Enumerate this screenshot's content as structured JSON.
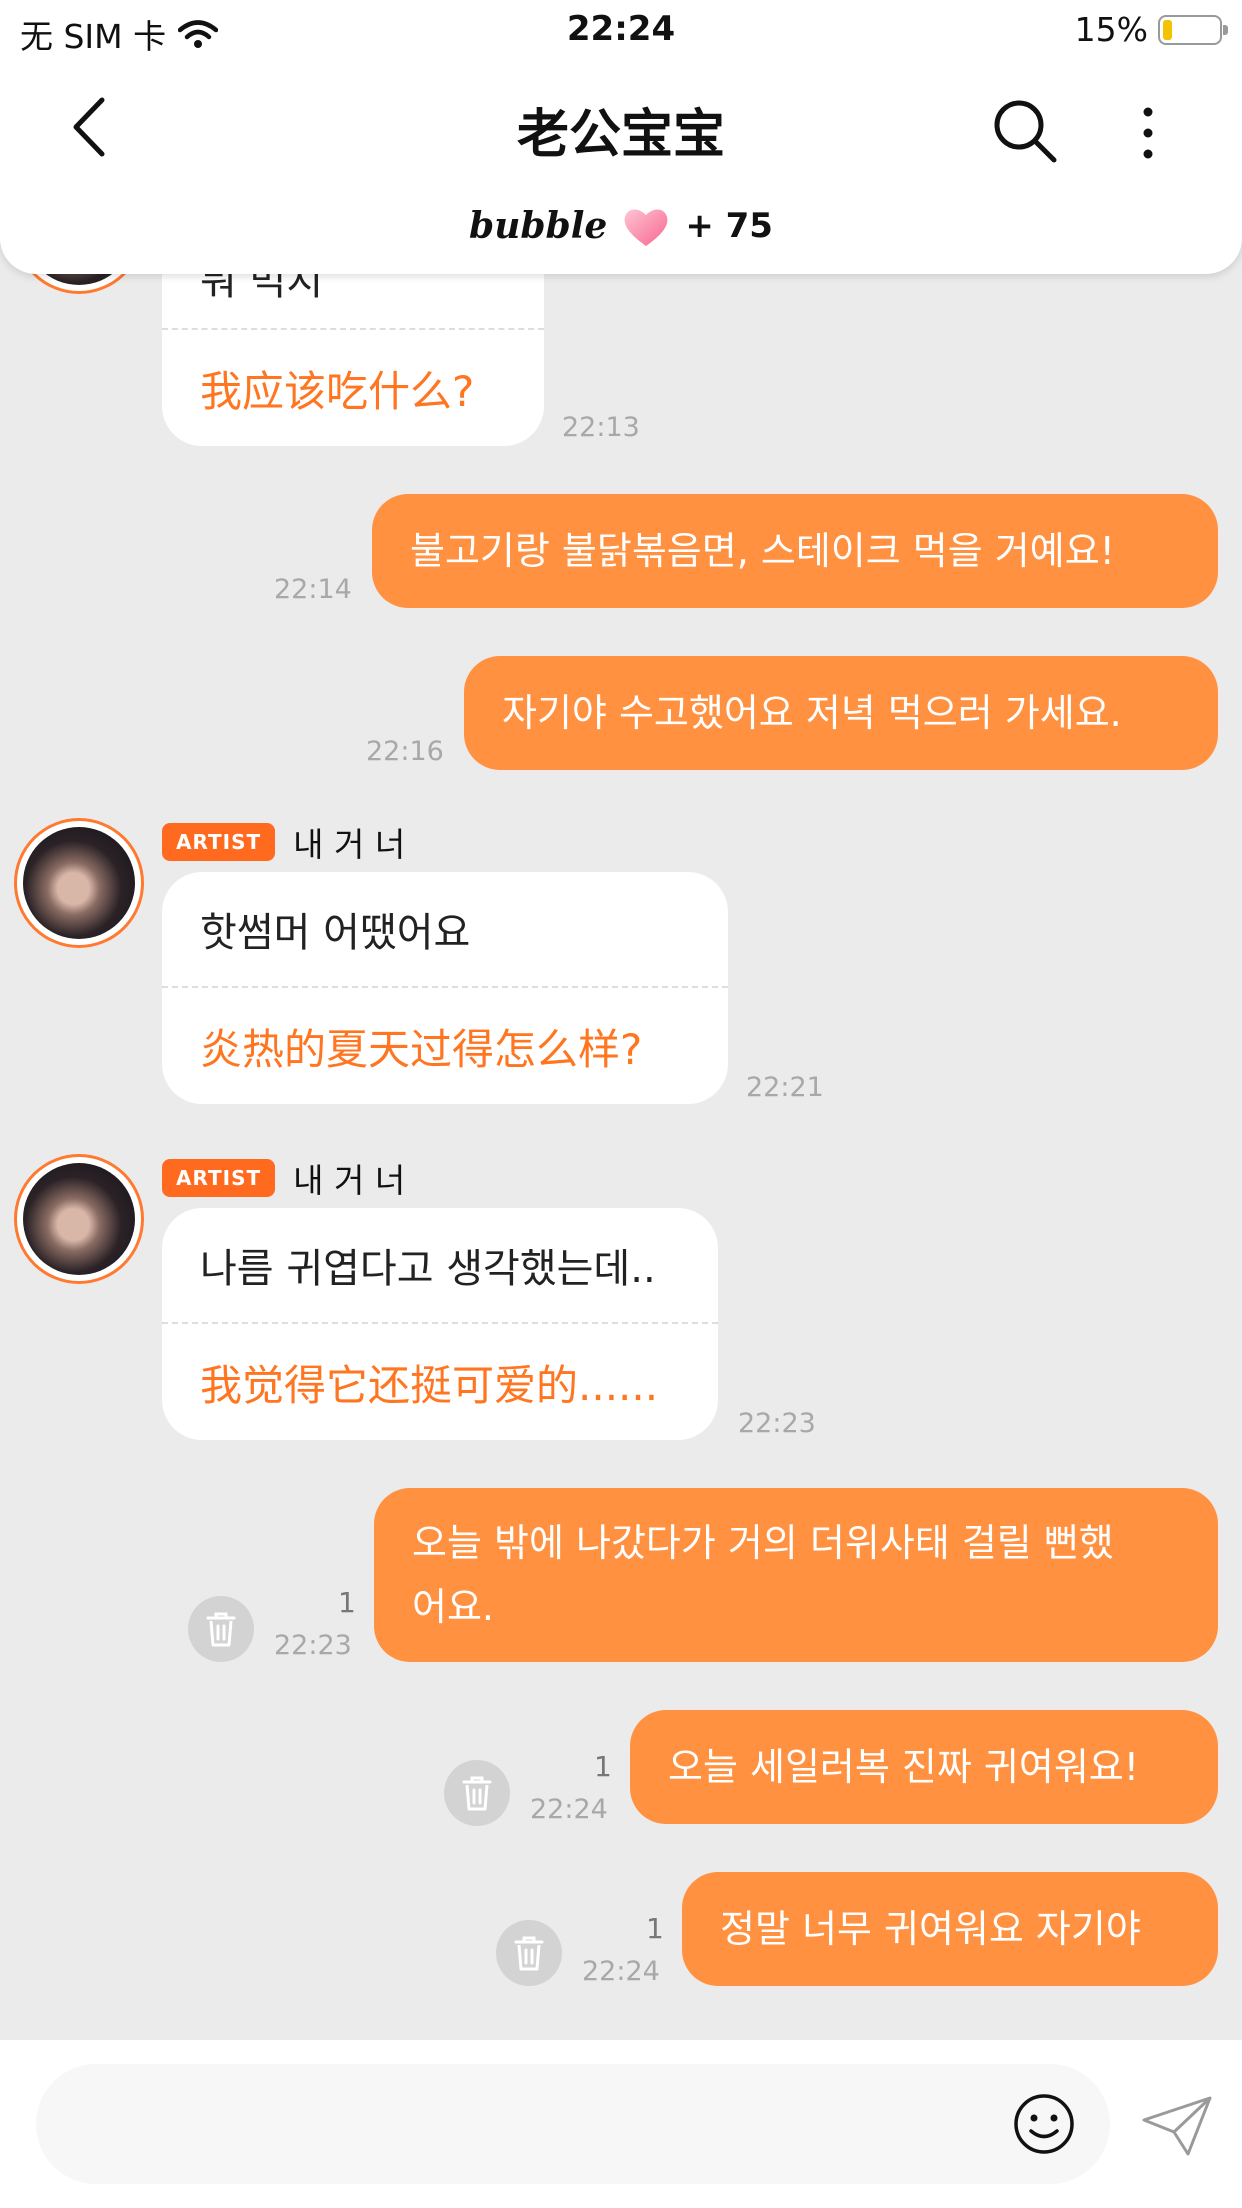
{
  "status": {
    "carrier": "无 SIM 卡",
    "time": "22:24",
    "battery": "15%",
    "battery_level": 0.15
  },
  "header": {
    "title": "老公宝宝",
    "bubble_logo": "bubble",
    "bubble_count": "+ 75"
  },
  "messages": [
    {
      "type": "in",
      "partial_ko": "뭐 먹지",
      "zh": "我应该吃什么?",
      "time": "22:13"
    },
    {
      "type": "out",
      "text": "불고기랑 불닭볶음면, 스테이크 먹을 거예요!",
      "time": "22:14"
    },
    {
      "type": "out",
      "text": "자기야 수고했어요 저녁 먹으러 가세요.",
      "time": "22:16"
    },
    {
      "type": "in",
      "badge": "ARTIST",
      "name": "내 거 너",
      "ko": "핫썸머 어땠어요",
      "zh": "炎热的夏天过得怎么样?",
      "time": "22:21"
    },
    {
      "type": "in",
      "badge": "ARTIST",
      "name": "내 거 너",
      "ko": "나름 귀엽다고 생각했는데..",
      "zh": "我觉得它还挺可爱的......",
      "time": "22:23"
    },
    {
      "type": "out",
      "line1": "오늘 밖에 나갔다가 거의 더위사태 걸릴 뻔했",
      "line2": "어요.",
      "read": "1",
      "time": "22:23"
    },
    {
      "type": "out",
      "text": "오늘 세일러복 진짜 귀여워요!",
      "read": "1",
      "time": "22:24"
    },
    {
      "type": "out",
      "text": "정말 너무 귀여워요 자기야",
      "read": "1",
      "time": "22:24"
    }
  ],
  "colors": {
    "accent": "#FF9141",
    "accent_text": "#FF7520",
    "badge": "#FF6A1F",
    "background": "#EBEBEB"
  },
  "icons": [
    "back-icon",
    "search-icon",
    "more-icon",
    "heart-icon",
    "trash-icon",
    "emoji-icon",
    "send-icon",
    "wifi-icon"
  ]
}
